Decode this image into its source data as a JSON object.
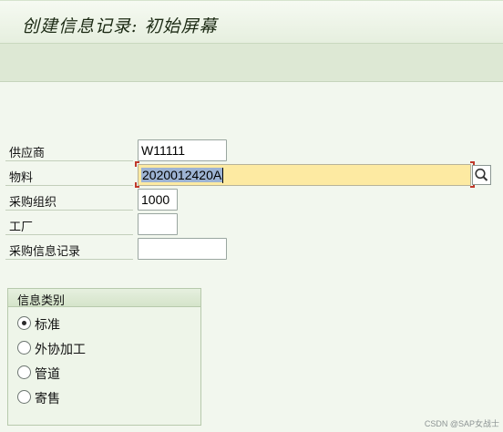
{
  "window": {
    "title": "创建信息记录: 初始屏幕"
  },
  "form": {
    "vendor": {
      "label": "供应商",
      "value": "W11111"
    },
    "material": {
      "label": "物料",
      "value": "2020012420A"
    },
    "purch_org": {
      "label": "采购组织",
      "value": "1000"
    },
    "plant": {
      "label": "工厂",
      "value": ""
    },
    "info_record": {
      "label": "采购信息记录",
      "value": ""
    }
  },
  "info_category": {
    "title": "信息类别",
    "options": [
      {
        "label": "标准",
        "selected": true
      },
      {
        "label": "外协加工",
        "selected": false
      },
      {
        "label": "管道",
        "selected": false
      },
      {
        "label": "寄售",
        "selected": false
      }
    ]
  },
  "icons": {
    "search_help": "magnifier-icon"
  },
  "colors": {
    "active_field": "#fdeaa2",
    "selection": "#9db3d3",
    "background": "#f2f7ee"
  },
  "watermark": "CSDN @SAP女战士"
}
